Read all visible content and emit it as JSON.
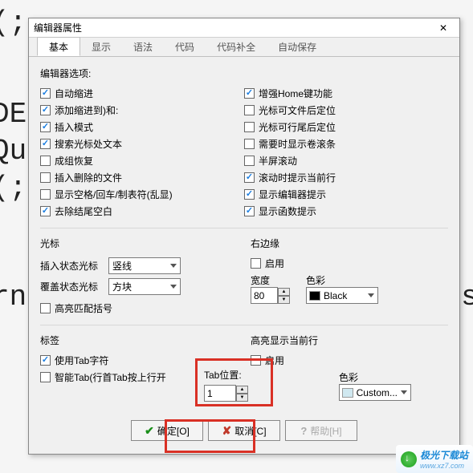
{
  "bg": {
    "t1": "(;",
    "t2": "DE",
    "t3": "Qu",
    "t4": "(;",
    "t5": "rn",
    "t6": "ess."
  },
  "dialog": {
    "title": "编辑器属性",
    "tabs": [
      "基本",
      "显示",
      "语法",
      "代码",
      "代码补全",
      "自动保存"
    ],
    "active_tab": 0,
    "options_label": "编辑器选项:",
    "checks_left": [
      {
        "label": "自动缩进",
        "checked": true
      },
      {
        "label": "添加缩进到)和:",
        "checked": true
      },
      {
        "label": "插入模式",
        "checked": true
      },
      {
        "label": "搜索光标处文本",
        "checked": true
      },
      {
        "label": "成组恢复",
        "checked": false
      },
      {
        "label": "插入删除的文件",
        "checked": false
      },
      {
        "label": "显示空格/回车/制表符(乱显)",
        "checked": false
      },
      {
        "label": "去除结尾空白",
        "checked": true
      }
    ],
    "checks_right": [
      {
        "label": "增强Home键功能",
        "checked": true
      },
      {
        "label": "光标可文件后定位",
        "checked": false
      },
      {
        "label": "光标可行尾后定位",
        "checked": false
      },
      {
        "label": "需要时显示卷滚条",
        "checked": false
      },
      {
        "label": "半屏滚动",
        "checked": false
      },
      {
        "label": "滚动时提示当前行",
        "checked": true
      },
      {
        "label": "显示编辑器提示",
        "checked": true
      },
      {
        "label": "显示函数提示",
        "checked": true
      }
    ],
    "cursor": {
      "group_label": "光标",
      "insert_label": "插入状态光标",
      "insert_value": "竖线",
      "over_label": "覆盖状态光标",
      "over_value": "方块",
      "match_label": "高亮匹配括号",
      "match_checked": false
    },
    "margin": {
      "group_label": "右边缘",
      "enable_label": "启用",
      "enable_checked": false,
      "width_label": "宽度",
      "width_value": "80",
      "color_label": "色彩",
      "color_value": "Black"
    },
    "tabsec": {
      "group_label": "标签",
      "use_tab_label": "使用Tab字符",
      "use_tab_checked": true,
      "smart_tab_label": "智能Tab(行首Tab按上行开",
      "smart_tab_checked": false,
      "pos_label": "Tab位置:",
      "pos_value": "1"
    },
    "highlight": {
      "group_label": "高亮显示当前行",
      "enable_label": "启用",
      "enable_checked": false,
      "color_label": "色彩",
      "color_value": "Custom..."
    },
    "buttons": {
      "ok": "确定[O]",
      "cancel": "取消[C]",
      "help": "帮助[H]"
    }
  },
  "logo": {
    "name": "极光下载站",
    "url": "www.xz7.com"
  }
}
